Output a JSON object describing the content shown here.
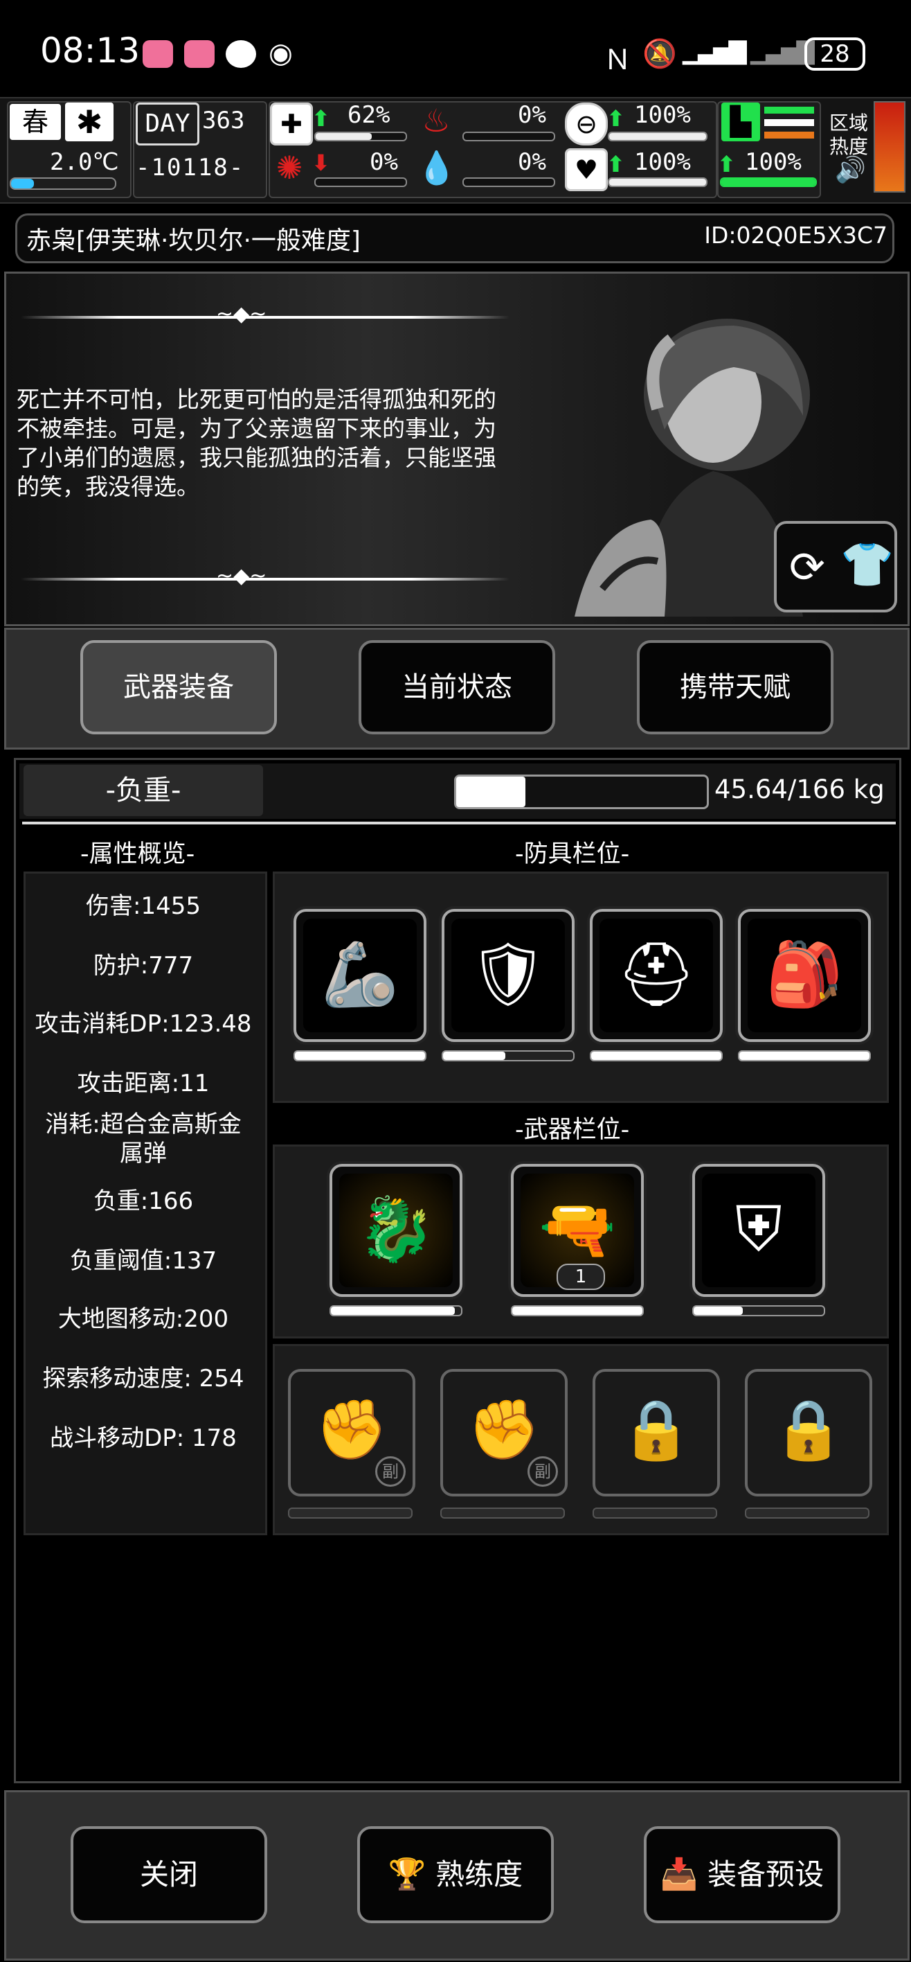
{
  "status_bar": {
    "time": "08:13",
    "battery": "28",
    "icons": [
      "bilibili-icon",
      "bilibili-icon",
      "chat-icon",
      "eye-icon",
      "nfc-icon",
      "mute-icon",
      "signal-icon",
      "signal-icon",
      "battery-icon"
    ]
  },
  "hud": {
    "season": "春",
    "temperature": "2.0℃",
    "day_label": "DAY",
    "day_number": "363",
    "coordinate": "-10118-",
    "health": "62%",
    "food": "0%",
    "armor": "100%",
    "infection": "0%",
    "blood": "0%",
    "heart": "100%",
    "stamina": "100%",
    "area_label": "区域",
    "heat_label": "热度"
  },
  "character": {
    "name": "赤枭[伊芙琳·坎贝尔·一般难度]",
    "id": "ID:02Q0E5X3C7",
    "quote": "死亡并不可怕，比死更可怕的是活得孤独和死的不被牵挂。可是，为了父亲遗留下来的事业，为了小弟们的遗愿，我只能孤独的活着，只能坚强的笑，我没得选。"
  },
  "tabs": [
    {
      "label": "武器装备",
      "active": true
    },
    {
      "label": "当前状态",
      "active": false
    },
    {
      "label": "携带天赋",
      "active": false
    }
  ],
  "load": {
    "label": "-负重-",
    "text": "45.64/166 kg",
    "fraction": 0.2749
  },
  "attributes": {
    "title": "-属性概览-",
    "items": [
      "伤害:1455",
      "防护:777",
      "攻击消耗DP:123.48",
      "攻击距离:11",
      "消耗:超合金高斯金属弹",
      "负重:166",
      "负重阈值:137",
      "大地图移动:200",
      "探索移动速度:  254",
      "战斗移动DP:  178"
    ]
  },
  "armor_section": {
    "title": "-防具栏位-",
    "slots": [
      {
        "icon": "arm-guard-icon",
        "durability": 1.0
      },
      {
        "icon": "chest-armor-icon",
        "durability": 0.48
      },
      {
        "icon": "helmet-icon",
        "durability": 1.0
      },
      {
        "icon": "backpack-icon",
        "durability": 1.0
      }
    ]
  },
  "weapon_section": {
    "title": "-武器栏位-",
    "slots": [
      {
        "icon": "dragon-staff-icon",
        "durability": 0.95
      },
      {
        "icon": "dragon-cannon-icon",
        "durability": 1.0,
        "count": "1"
      },
      {
        "icon": "dragon-shield-icon",
        "durability": 0.38
      }
    ],
    "empty_slots": [
      {
        "icon": "fist-icon",
        "badge": "副"
      },
      {
        "icon": "fist-icon",
        "badge": "副"
      },
      {
        "icon": "lock-icon",
        "badge": ""
      },
      {
        "icon": "lock-icon",
        "badge": ""
      }
    ]
  },
  "bottom_buttons": {
    "close": "关闭",
    "proficiency": "熟练度",
    "preset": "装备预设"
  }
}
